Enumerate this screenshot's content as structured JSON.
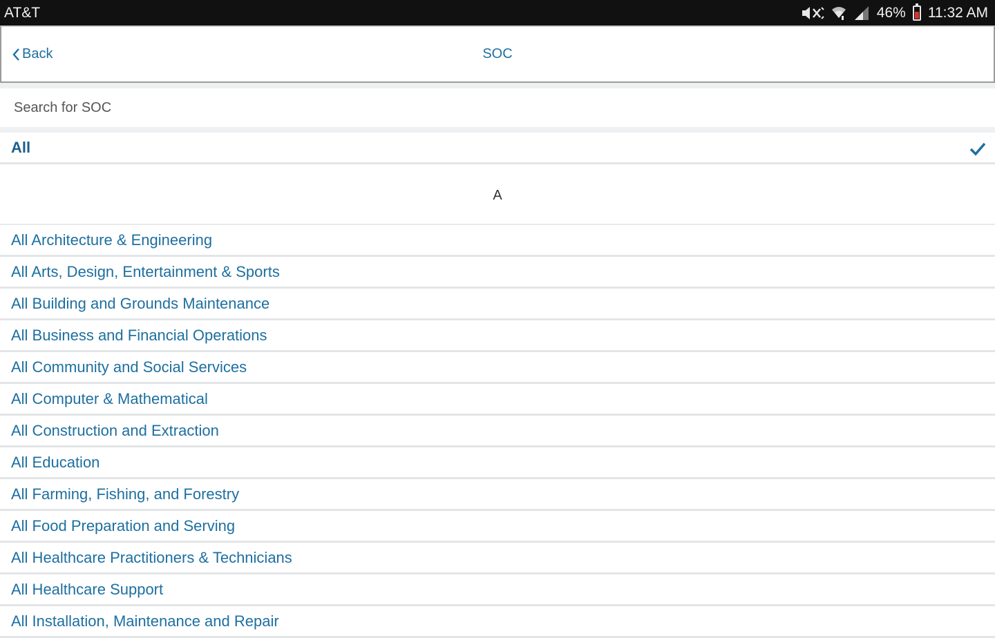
{
  "status_bar": {
    "carrier": "AT&T",
    "battery": "46%",
    "time": "11:32 AM",
    "icons": [
      "mute-icon",
      "wifi-icon",
      "signal-icon",
      "battery-icon"
    ]
  },
  "nav": {
    "back_label": "Back",
    "title": "SOC"
  },
  "search": {
    "placeholder": "Search for SOC",
    "value": ""
  },
  "all_option": {
    "label": "All",
    "selected": true
  },
  "section": {
    "letter": "A"
  },
  "categories": [
    "All Architecture & Engineering",
    "All Arts, Design, Entertainment & Sports",
    "All Building and Grounds Maintenance",
    "All Business and Financial Operations",
    "All Community and Social Services",
    "All Computer & Mathematical",
    "All Construction and Extraction",
    "All Education",
    "All Farming, Fishing, and Forestry",
    "All Food Preparation and Serving",
    "All Healthcare Practitioners & Technicians",
    "All Healthcare Support",
    "All Installation, Maintenance and Repair"
  ],
  "colors": {
    "accent": "#1d6fa0",
    "selected_text": "#1b5f8c",
    "status_bar": "#111111"
  }
}
